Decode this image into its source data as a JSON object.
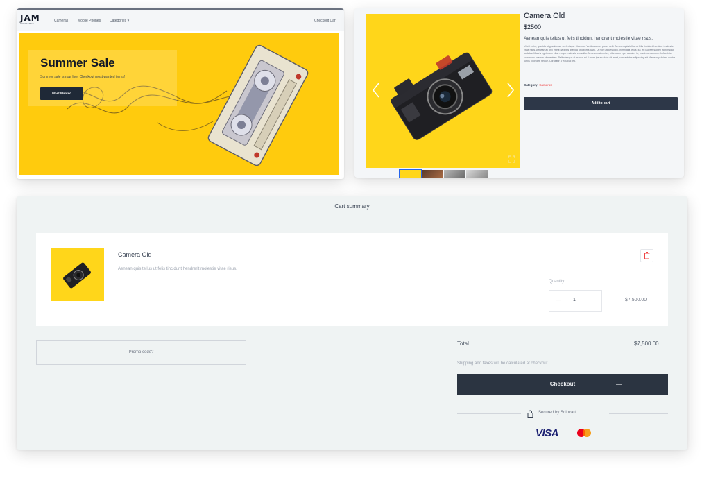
{
  "home": {
    "logo": "JAM",
    "logo_sub": "COMMERCE",
    "nav": [
      "Cameras",
      "Mobile Phones",
      "Categories"
    ],
    "categories_caret": "▾",
    "checkout_link": "Checkout Cart",
    "hero": {
      "title": "Summer Sale",
      "subtitle": "Summer sale is now live. Checkout most wanted items!",
      "button": "Most Wanted",
      "background": "#ffcb0d"
    }
  },
  "product": {
    "title": "Camera Old",
    "price": "$2500",
    "short_description": "Aenean quis tellus ut felis tincidunt hendrerit molestie vitae risus.",
    "long_description": "Ut elit enim, gravida at gravida ac, scelerisque vitae nisi. Vestibulum et purus velit. Aenean quis tellus ut felis tincidunt hendrerit molestie vitae risus. Aenean ac orci et elit dapibus gravida ut lobortis justo. Ut non ultrices odio. In fringilla tellus dui, eu laoreet sapien scelerisque sodales. Mauris eget nunc vitae neque molestie convallis. Aenean nisl metus, bibendum eget sodales id, maximus ac nunc. In facilisis commodo lorem a elementum. Pellentesque at massa mi. Lorem ipsum dolor sit amet, consectetur adipiscing elit. Aenean pulvinar auctor turpis id ornare neque. Curabitur a volutpat leo.",
    "category_label": "Category:",
    "category_value": "Cameras",
    "add_to_cart": "Add to cart",
    "prev_icon": "chevron-left-icon",
    "next_icon": "chevron-right-icon",
    "fullscreen_icon": "expand-icon"
  },
  "cart": {
    "title": "Cart summary",
    "item": {
      "name": "Camera Old",
      "description": "Aenean quis tellus ut felis tincidunt hendrerit molestie vitae risus.",
      "quantity_label": "Quantity",
      "quantity": "1",
      "minus": "—",
      "line_total": "$7,500.00"
    },
    "promo_placeholder": "Promo code?",
    "total_label": "Total",
    "total_value": "$7,500.00",
    "shipping_note": "Shipping and taxes will be calculated at checkout.",
    "checkout": "Checkout",
    "secured_by": "Secured by Snipcart",
    "payment_logos": [
      "VISA",
      "Mastercard"
    ],
    "accent": "#2b3441"
  }
}
